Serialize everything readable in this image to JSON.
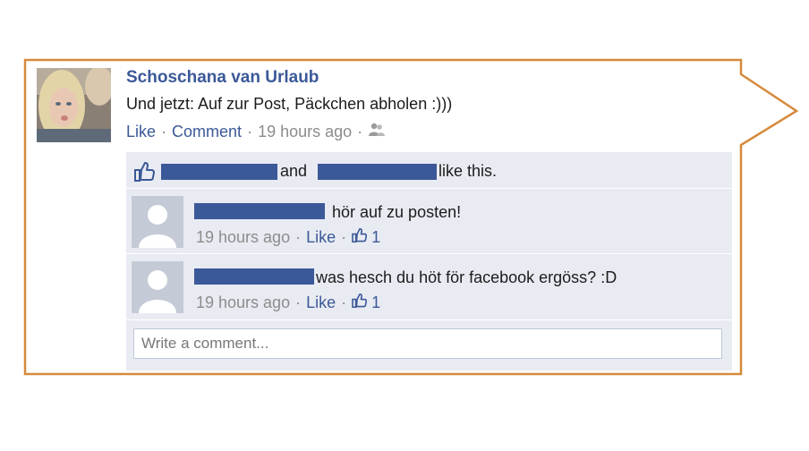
{
  "post": {
    "author": "Schoschana van Urlaub",
    "text": "Und jetzt: Auf zur Post, Päckchen abholen :)))",
    "actions": {
      "like_label": "Like",
      "comment_label": "Comment",
      "timestamp": "19 hours ago",
      "separator": "·",
      "audience_icon": "friends-icon"
    }
  },
  "likes_summary": {
    "conjunction": "and",
    "suffix": "like this.",
    "icon": "thumbs-up-icon"
  },
  "comments": [
    {
      "text": "hör auf zu posten!",
      "timestamp": "19 hours ago",
      "like_label": "Like",
      "like_count": "1"
    },
    {
      "text": "was hesch du höt för facebook ergöss? :D",
      "timestamp": "19 hours ago",
      "like_label": "Like",
      "like_count": "1"
    }
  ],
  "comment_box": {
    "placeholder": "Write a comment..."
  },
  "colors": {
    "bubble_border": "#d58a3c",
    "link": "#3b5998",
    "panel": "#e9ebf3",
    "redaction": "#3b5998"
  }
}
